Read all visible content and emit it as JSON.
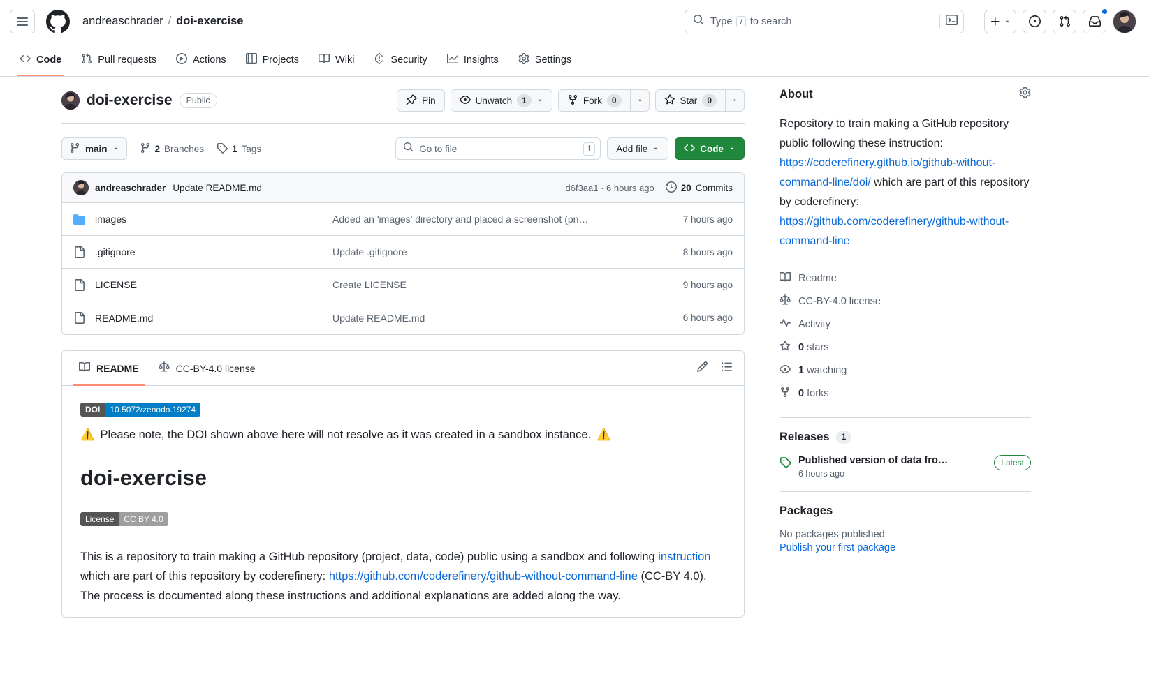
{
  "appbar": {
    "owner": "andreaschrader",
    "separator": "/",
    "repo": "doi-exercise",
    "search_placeholder_pre": "Type",
    "search_key": "/",
    "search_placeholder_post": "to search"
  },
  "repo_nav": [
    {
      "label": "Code",
      "icon": "code-icon",
      "active": true
    },
    {
      "label": "Pull requests",
      "icon": "git-pull-request-icon",
      "active": false
    },
    {
      "label": "Actions",
      "icon": "play-icon",
      "active": false
    },
    {
      "label": "Projects",
      "icon": "table-icon",
      "active": false
    },
    {
      "label": "Wiki",
      "icon": "book-icon",
      "active": false
    },
    {
      "label": "Security",
      "icon": "shield-icon",
      "active": false
    },
    {
      "label": "Insights",
      "icon": "graph-icon",
      "active": false
    },
    {
      "label": "Settings",
      "icon": "gear-icon",
      "active": false
    }
  ],
  "repo_header": {
    "name": "doi-exercise",
    "visibility": "Public",
    "actions": {
      "pin": "Pin",
      "unwatch": "Unwatch",
      "unwatch_count": "1",
      "fork": "Fork",
      "fork_count": "0",
      "star": "Star",
      "star_count": "0"
    }
  },
  "toolbar": {
    "branch": "main",
    "branches_count": "2",
    "branches_label": "Branches",
    "tags_count": "1",
    "tags_label": "Tags",
    "gotofile_placeholder": "Go to file",
    "gotofile_key": "t",
    "add_file": "Add file",
    "code": "Code"
  },
  "commit_bar": {
    "author": "andreaschrader",
    "message": "Update README.md",
    "hash_and_time": "d6f3aa1 · 6 hours ago",
    "commits_count": "20",
    "commits_label": "Commits"
  },
  "files": [
    {
      "name": "images",
      "type": "folder",
      "message": "Added an 'images' directory and placed a screenshot (pn…",
      "time": "7 hours ago"
    },
    {
      "name": ".gitignore",
      "type": "file",
      "message": "Update .gitignore",
      "time": "8 hours ago"
    },
    {
      "name": "LICENSE",
      "type": "file",
      "message": "Create LICENSE",
      "time": "9 hours ago"
    },
    {
      "name": "README.md",
      "type": "file",
      "message": "Update README.md",
      "time": "6 hours ago"
    }
  ],
  "readme": {
    "tabs": [
      {
        "label": "README",
        "icon": "book-icon",
        "active": true
      },
      {
        "label": "CC-BY-4.0 license",
        "icon": "law-icon",
        "active": false
      }
    ],
    "doi_badge_left": "DOI",
    "doi_badge_right": "10.5072/zenodo.19274",
    "warning_icon_left": "⚠️",
    "warning_text": "Please note, the DOI shown above here will not resolve as it was created in a sandbox instance.",
    "warning_icon_right": "⚠️",
    "heading": "doi-exercise",
    "license_badge_left": "License",
    "license_badge_right": "CC BY 4.0",
    "body_part1": "This is a repository to train making a GitHub repository (project, data, code) public using a sandbox and following ",
    "body_link1": "instruction",
    "body_part2": " which are part of this repository by coderefinery: ",
    "body_link2": "https://github.com/coderefinery/github-without-command-line",
    "body_part3": " (CC-BY 4.0). The process is documented along these instructions and additional explanations are added along the way."
  },
  "about": {
    "title": "About",
    "desc_part1": "Repository to train making a GitHub repository public following these instruction: ",
    "desc_link1": "https://coderefinery.github.io/github-without-command-line/doi/",
    "desc_part2": " which are part of this repository by coderefinery: ",
    "desc_link2": "https://github.com/coderefinery/github-without-command-line",
    "items": [
      {
        "label": "Readme",
        "icon": "book-icon"
      },
      {
        "label": "CC-BY-4.0 license",
        "icon": "law-icon"
      },
      {
        "label": "Activity",
        "icon": "pulse-icon"
      },
      {
        "label": "0 stars",
        "icon": "star-icon",
        "bold_prefix": "0",
        "rest": " stars"
      },
      {
        "label": "1 watching",
        "icon": "eye-icon",
        "bold_prefix": "1",
        "rest": " watching"
      },
      {
        "label": "0 forks",
        "icon": "fork-icon",
        "bold_prefix": "0",
        "rest": " forks"
      }
    ]
  },
  "releases": {
    "title": "Releases",
    "count": "1",
    "item_title": "Published version of data fro…",
    "item_time": "6 hours ago",
    "latest_badge": "Latest"
  },
  "packages": {
    "title": "Packages",
    "empty_text": "No packages published",
    "link_text": "Publish your first package"
  },
  "colors": {
    "accent": "#0969da",
    "green": "#1f883d",
    "orange_underline": "#fd8c73",
    "border": "#d1d9e0",
    "muted": "#59636e",
    "doi_blue": "#007ec6"
  }
}
